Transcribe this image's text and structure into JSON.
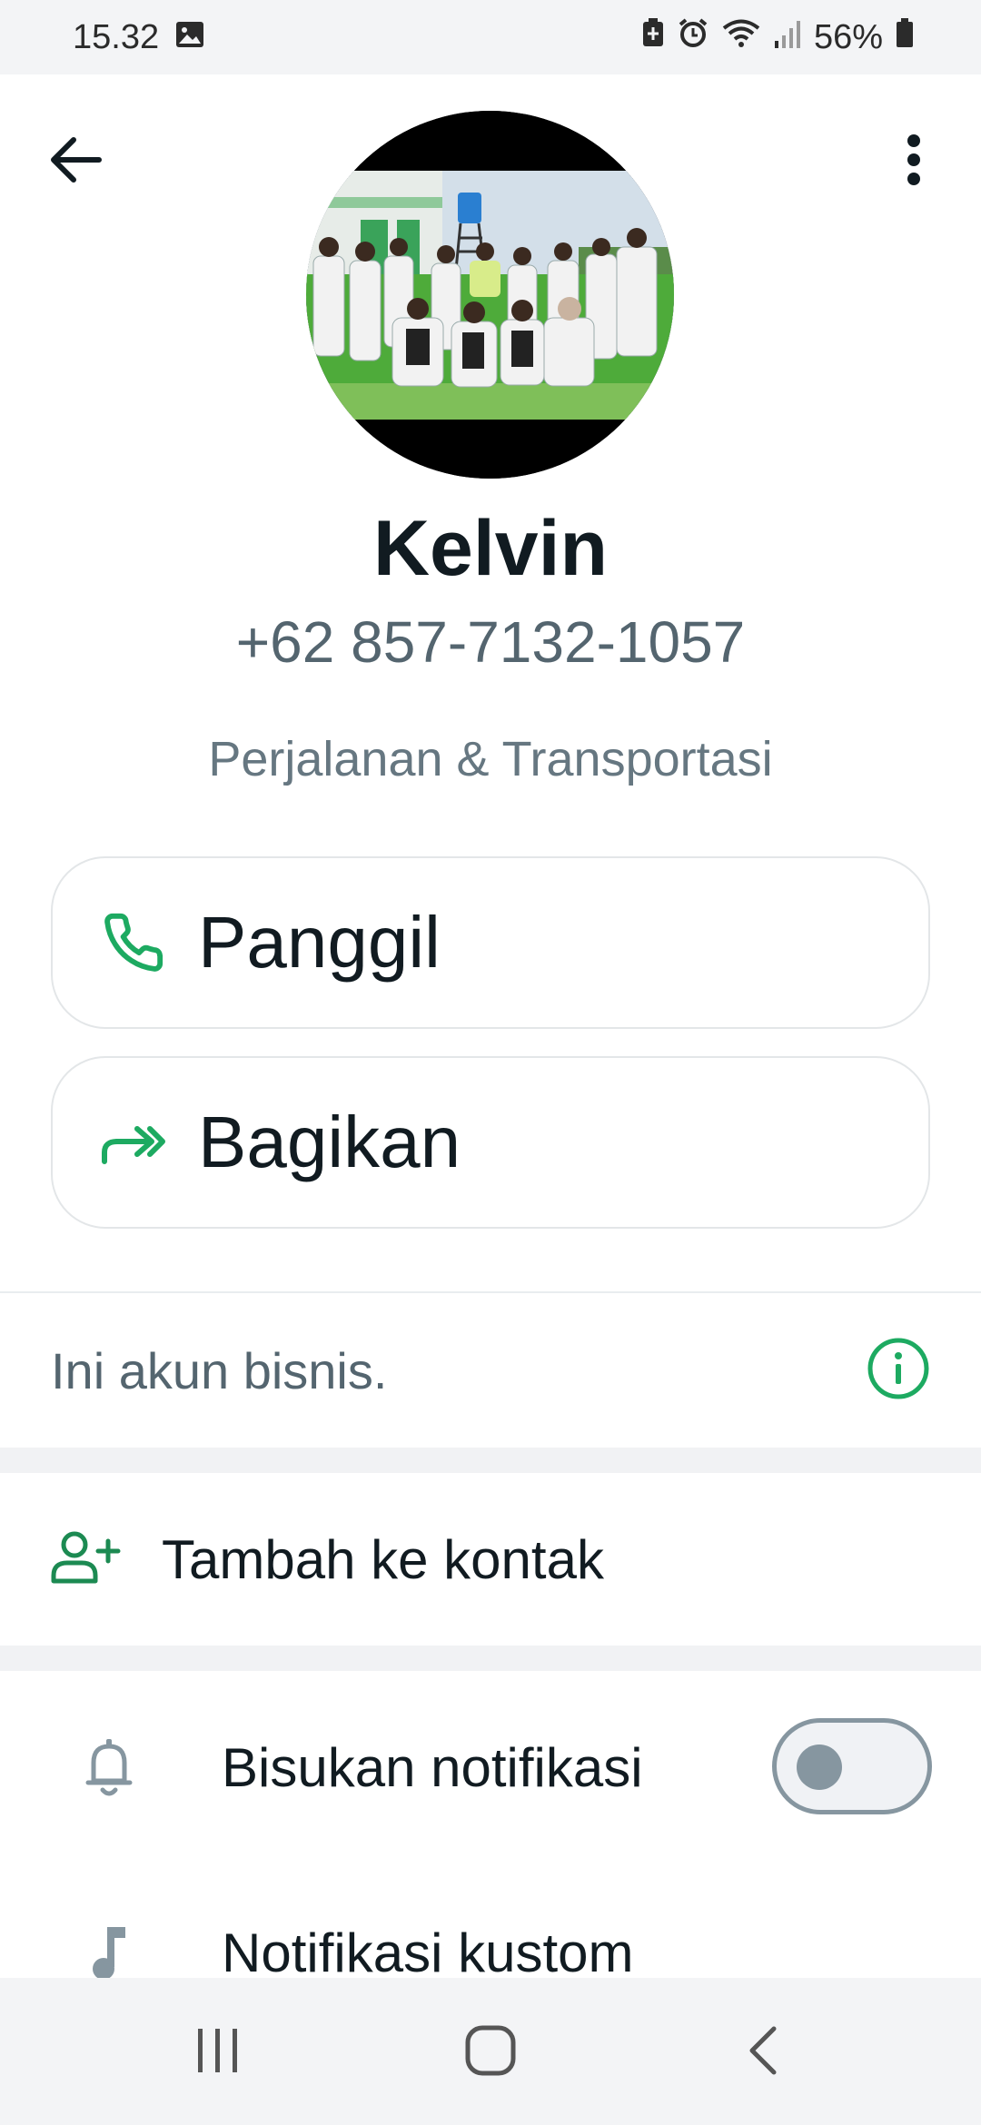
{
  "status_bar": {
    "time": "15.32",
    "battery": "56%"
  },
  "contact": {
    "name": "Kelvin",
    "phone": "+62 857-7132-1057",
    "category": "Perjalanan & Transportasi"
  },
  "actions": {
    "call_label": "Panggil",
    "share_label": "Bagikan"
  },
  "business_notice": {
    "text": "Ini akun bisnis."
  },
  "add_contact": {
    "label": "Tambah ke kontak"
  },
  "settings": {
    "mute_label": "Bisukan notifikasi",
    "mute_enabled": false,
    "custom_label": "Notifikasi kustom"
  },
  "colors": {
    "accent_green": "#1daa61",
    "text_primary": "#111b21",
    "text_secondary": "#667781"
  },
  "icons": {
    "back": "arrow-left-icon",
    "menu": "more-vertical-icon",
    "call": "phone-icon",
    "share": "share-icon",
    "info": "info-icon",
    "add_contact": "user-plus-icon",
    "mute": "bell-icon",
    "custom": "music-note-icon"
  }
}
